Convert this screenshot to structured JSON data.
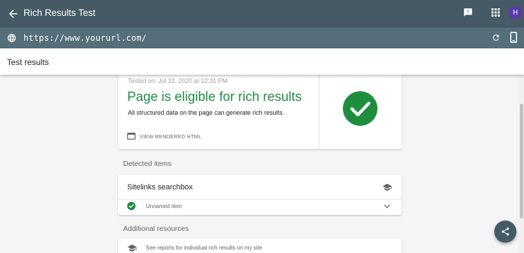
{
  "app": {
    "title": "Rich Results Test",
    "avatar_letter": "H",
    "bar_color": "#455a64",
    "url_bar_color": "#546e7a"
  },
  "url_bar": {
    "url": "https://www.yoururl.com/"
  },
  "subheader": {
    "title": "Test results"
  },
  "result": {
    "tested_on": "Tested on: Jul 31, 2020 at 12:31 PM",
    "headline": "Page is eligible for rich results",
    "description": "All structured data on the page can generate rich results.",
    "view_rendered_label": "VIEW RENDERED HTML",
    "status_color": "#1e8e3e"
  },
  "detected": {
    "section_label": "Detected items",
    "item_title": "Sitelinks searchbox",
    "sub_item": "Unnamed item"
  },
  "resources": {
    "section_label": "Additional resources",
    "link_text": "See reports for individual rich results on my site"
  },
  "icons": {
    "back": "arrow-back-icon",
    "feedback": "feedback-icon",
    "apps": "apps-grid-icon",
    "globe": "globe-icon",
    "refresh": "refresh-icon",
    "mobile": "smartphone-icon",
    "code": "code-window-icon",
    "check": "check-circle-icon",
    "school": "school-cap-icon",
    "chevron": "chevron-down-icon",
    "share": "share-icon"
  }
}
